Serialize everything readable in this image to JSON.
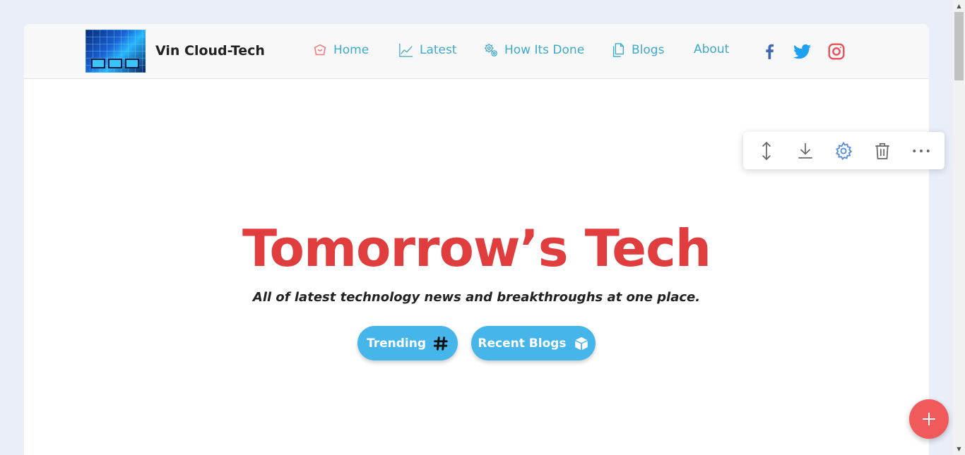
{
  "brand": {
    "name": "Vin Cloud-Tech",
    "logo_icon": "datacenter-screens-image"
  },
  "nav": {
    "items": [
      {
        "label": "Home",
        "icon": "home-icon"
      },
      {
        "label": "Latest",
        "icon": "chart-line-icon"
      },
      {
        "label": "How Its Done",
        "icon": "gears-icon"
      },
      {
        "label": "Blogs",
        "icon": "documents-icon"
      },
      {
        "label": "About",
        "icon": ""
      }
    ],
    "social": [
      {
        "name": "facebook-icon",
        "color": "#4267b2"
      },
      {
        "name": "twitter-icon",
        "color": "#1da1f2"
      },
      {
        "name": "instagram-icon",
        "color": "#e1306c"
      }
    ]
  },
  "hero": {
    "title": "Tomorrow’s Tech",
    "subtitle": "All of latest technology news and breakthroughs at one place.",
    "buttons": [
      {
        "label": "Trending",
        "icon": "hashtag-icon"
      },
      {
        "label": "Recent Blogs",
        "icon": "cube-icon"
      }
    ]
  },
  "toolbar": {
    "tools": [
      "move-vertical-icon",
      "download-icon",
      "settings-icon",
      "trash-icon",
      "more-icon"
    ]
  },
  "fab": {
    "icon": "plus-icon"
  },
  "colors": {
    "accent_nav": "#3fa9c9",
    "hero_title": "#e03e3e",
    "button_bg": "#45b5ea",
    "fab_bg": "#f05a5a",
    "page_bg": "#e9eef9"
  }
}
